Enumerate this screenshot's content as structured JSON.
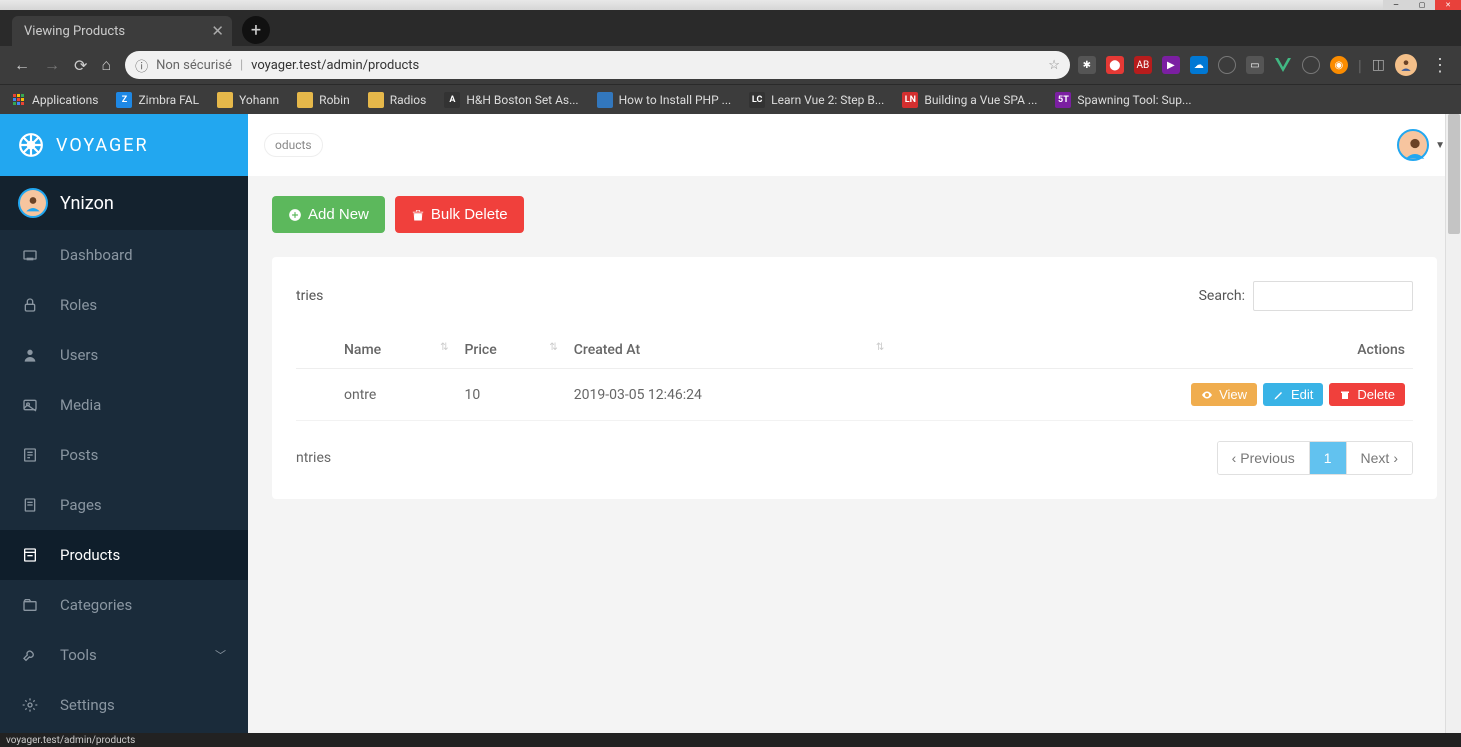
{
  "os": {
    "min": "—",
    "max": "▢",
    "close": "✕"
  },
  "browser": {
    "tab_title": "Viewing Products",
    "url_insecure_label": "Non sécurisé",
    "url": "voyager.test/admin/products",
    "bookmarks": [
      {
        "icon": "apps",
        "label": "Applications"
      },
      {
        "icon": "Z",
        "color": "#1e88e5",
        "label": "Zimbra FAL"
      },
      {
        "icon": "fold",
        "label": "Yohann"
      },
      {
        "icon": "fold",
        "label": "Robin"
      },
      {
        "icon": "fold",
        "label": "Radios"
      },
      {
        "icon": "a",
        "color": "#333",
        "label": "H&H Boston Set As..."
      },
      {
        "icon": "php",
        "color": "#3277bd",
        "label": "How to Install PHP ..."
      },
      {
        "icon": "lc",
        "color": "#333",
        "label": "Learn Vue 2: Step B..."
      },
      {
        "icon": "LN",
        "color": "#d32f2f",
        "label": "Building a Vue SPA ..."
      },
      {
        "icon": "5t",
        "color": "#7b1fa2",
        "label": "Spawning Tool: Sup..."
      }
    ]
  },
  "app": {
    "brand": "VOYAGER",
    "user": "Ynizon",
    "breadcrumb": "oducts",
    "nav": [
      {
        "icon": "dashboard",
        "label": "Dashboard"
      },
      {
        "icon": "lock",
        "label": "Roles"
      },
      {
        "icon": "user",
        "label": "Users"
      },
      {
        "icon": "media",
        "label": "Media"
      },
      {
        "icon": "posts",
        "label": "Posts"
      },
      {
        "icon": "pages",
        "label": "Pages"
      },
      {
        "icon": "products",
        "label": "Products"
      },
      {
        "icon": "categories",
        "label": "Categories"
      },
      {
        "icon": "tools",
        "label": "Tools",
        "chev": true
      },
      {
        "icon": "settings",
        "label": "Settings"
      }
    ],
    "active_nav": 6,
    "buttons": {
      "add": "Add New",
      "bulk_delete": "Bulk Delete",
      "view": "View",
      "edit": "Edit",
      "delete": "Delete"
    },
    "table": {
      "entries_text": "tries",
      "search_label": "Search:",
      "headers": [
        "Name",
        "Price",
        "Created At",
        "Actions"
      ],
      "rows": [
        {
          "name": "ontre",
          "price": "10",
          "created": "2019-03-05 12:46:24"
        }
      ],
      "showing": "ntries",
      "pager": {
        "prev": "Previous",
        "page": "1",
        "next": "Next"
      }
    }
  },
  "status_bar": "voyager.test/admin/products"
}
